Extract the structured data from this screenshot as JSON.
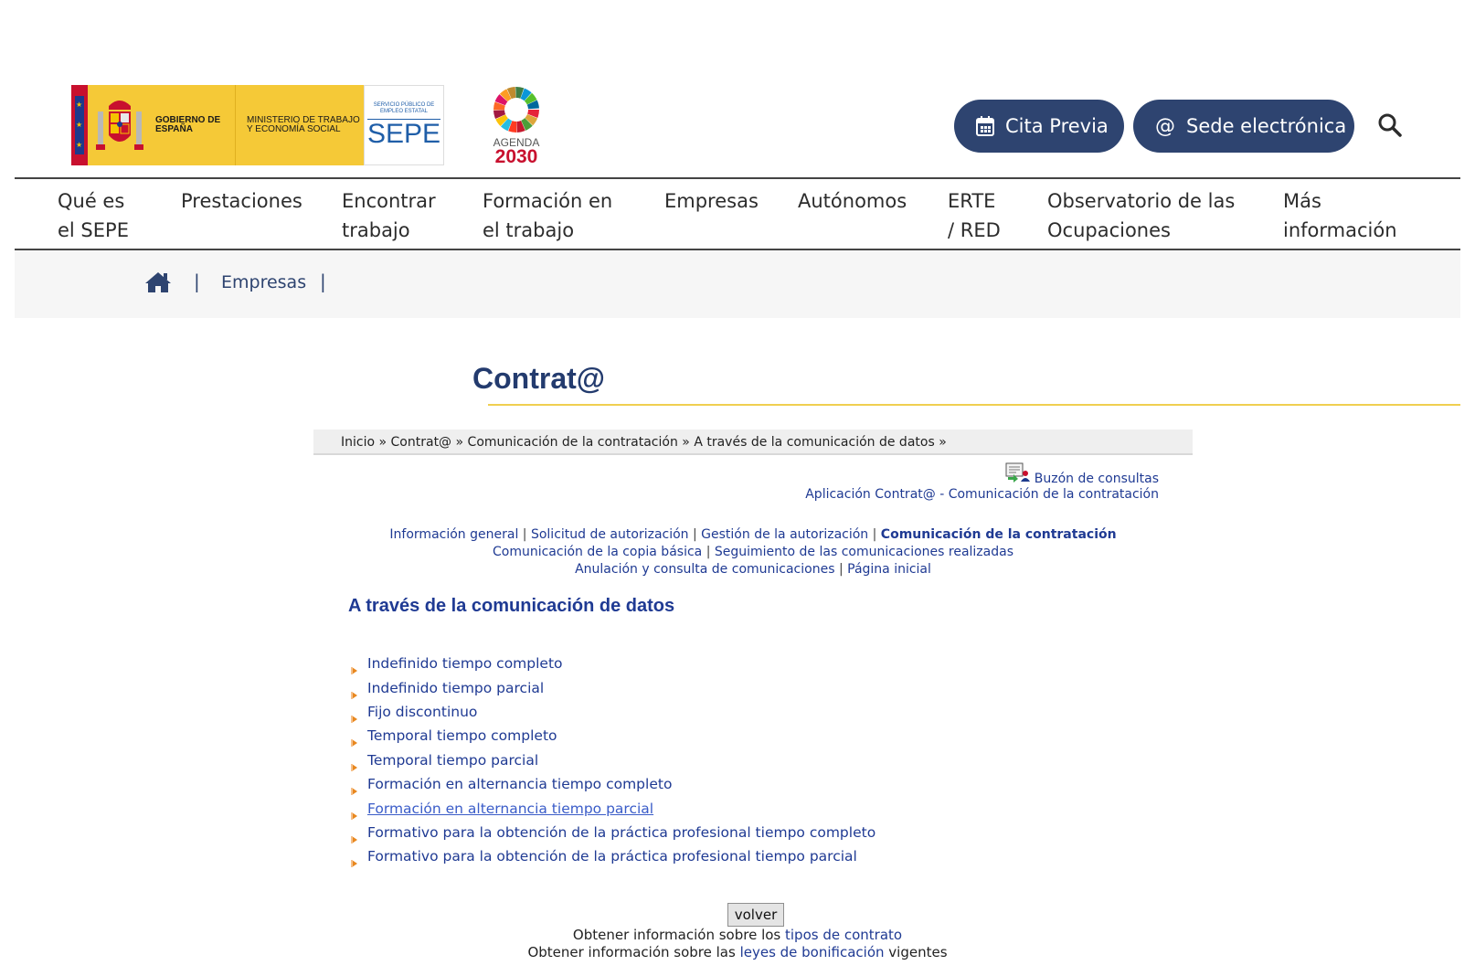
{
  "header": {
    "gov_label": "GOBIERNO DE ESPAÑA",
    "ministry_label": "MINISTERIO DE TRABAJO Y ECONOMÍA SOCIAL",
    "sepe_small": "SERVICIO PÚBLICO DE EMPLEO ESTATAL",
    "sepe_big": "SEPE",
    "agenda_label": "AGENDA",
    "agenda_year": "2030",
    "cita_label": "Cita Previa",
    "sede_label": "Sede electrónica"
  },
  "nav": {
    "items": [
      {
        "l1": "Qué es",
        "l2": "el SEPE"
      },
      {
        "l1": "Prestaciones",
        "l2": ""
      },
      {
        "l1": "Encontrar",
        "l2": "trabajo"
      },
      {
        "l1": "Formación en",
        "l2": "el trabajo"
      },
      {
        "l1": "Empresas",
        "l2": ""
      },
      {
        "l1": "Autónomos",
        "l2": ""
      },
      {
        "l1": "ERTE",
        "l2": "/ RED"
      },
      {
        "l1": "Observatorio de las",
        "l2": "Ocupaciones"
      },
      {
        "l1": "Más",
        "l2": "información"
      }
    ]
  },
  "breadcrumb": {
    "sep": "|",
    "section": "Empresas"
  },
  "page": {
    "title": "Contrat@"
  },
  "inner": {
    "crumb": [
      "Inicio",
      "Contrat@",
      "Comunicación de la contratación",
      "A través de la comunicación de datos"
    ],
    "crumb_sep": "»",
    "buzon": "Buzón de consultas",
    "app_link": "Aplicación Contrat@ - Comunicación de la contratación",
    "tabs_row1": [
      "Información general",
      "Solicitud de autorización",
      "Gestión de la autorización",
      "Comunicación de la contratación"
    ],
    "tabs_row2": [
      "Comunicación de la copia básica",
      "Seguimiento de las comunicaciones realizadas"
    ],
    "tabs_row3": [
      "Anulación y consulta de comunicaciones",
      "Página inicial"
    ],
    "tab_sep": "|",
    "subtitle": "A través de la comunicación de datos",
    "contracts": [
      "Indefinido tiempo completo",
      "Indefinido tiempo parcial",
      "Fijo discontinuo",
      "Temporal tiempo completo",
      "Temporal tiempo parcial",
      "Formación en alternancia tiempo completo",
      "Formación en alternancia tiempo parcial",
      "Formativo para la obtención de la práctica profesional tiempo completo",
      "Formativo para la obtención de la práctica profesional tiempo parcial"
    ],
    "volver": "volver",
    "info1_pre": "Obtener información sobre los ",
    "info1_link": "tipos de contrato",
    "info2_pre": "Obtener información sobre las ",
    "info2_link": "leyes de bonificación",
    "info2_post": " vigentes"
  },
  "colors": {
    "brand_navy": "#2e4470",
    "link_blue": "#1f3a93",
    "accent_yellow": "#f0cf50",
    "bullet_orange": "#e8871e"
  }
}
